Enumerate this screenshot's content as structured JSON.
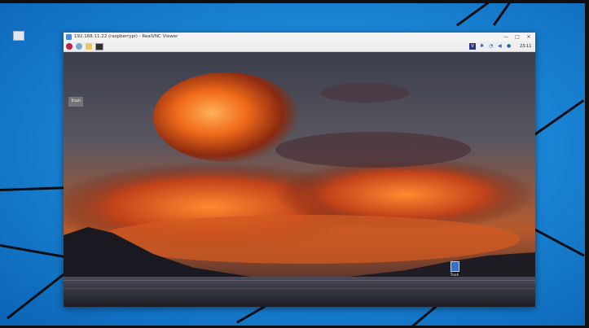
{
  "host": {
    "desktop_icon": {
      "icon": "recycle-bin-icon"
    }
  },
  "vnc_window": {
    "title": "192.168.11.22 (raspberrypi) - RealVNC Viewer",
    "controls": {
      "minimize": "—",
      "maximize": "□",
      "close": "✕"
    }
  },
  "pi_panel": {
    "launchers": [
      {
        "name": "raspberry-menu-icon"
      },
      {
        "name": "browser-globe-icon"
      },
      {
        "name": "file-manager-folder-icon"
      },
      {
        "name": "terminal-icon"
      }
    ],
    "tray": {
      "vnc": "V",
      "bluetooth": "✱",
      "wifi": "◔",
      "volume": "◀",
      "mic": "●",
      "clock": "23:11"
    }
  },
  "pi_desktop": {
    "wallpaper": "sunset-over-lake",
    "trash_label": "Trash",
    "trash_bottom_label": "Trash"
  },
  "colors": {
    "host_bg": "#1b86d6",
    "window_chrome": "#f3f3f3",
    "panel": "#eeeeee",
    "pi_accent": "#c41f4a"
  }
}
